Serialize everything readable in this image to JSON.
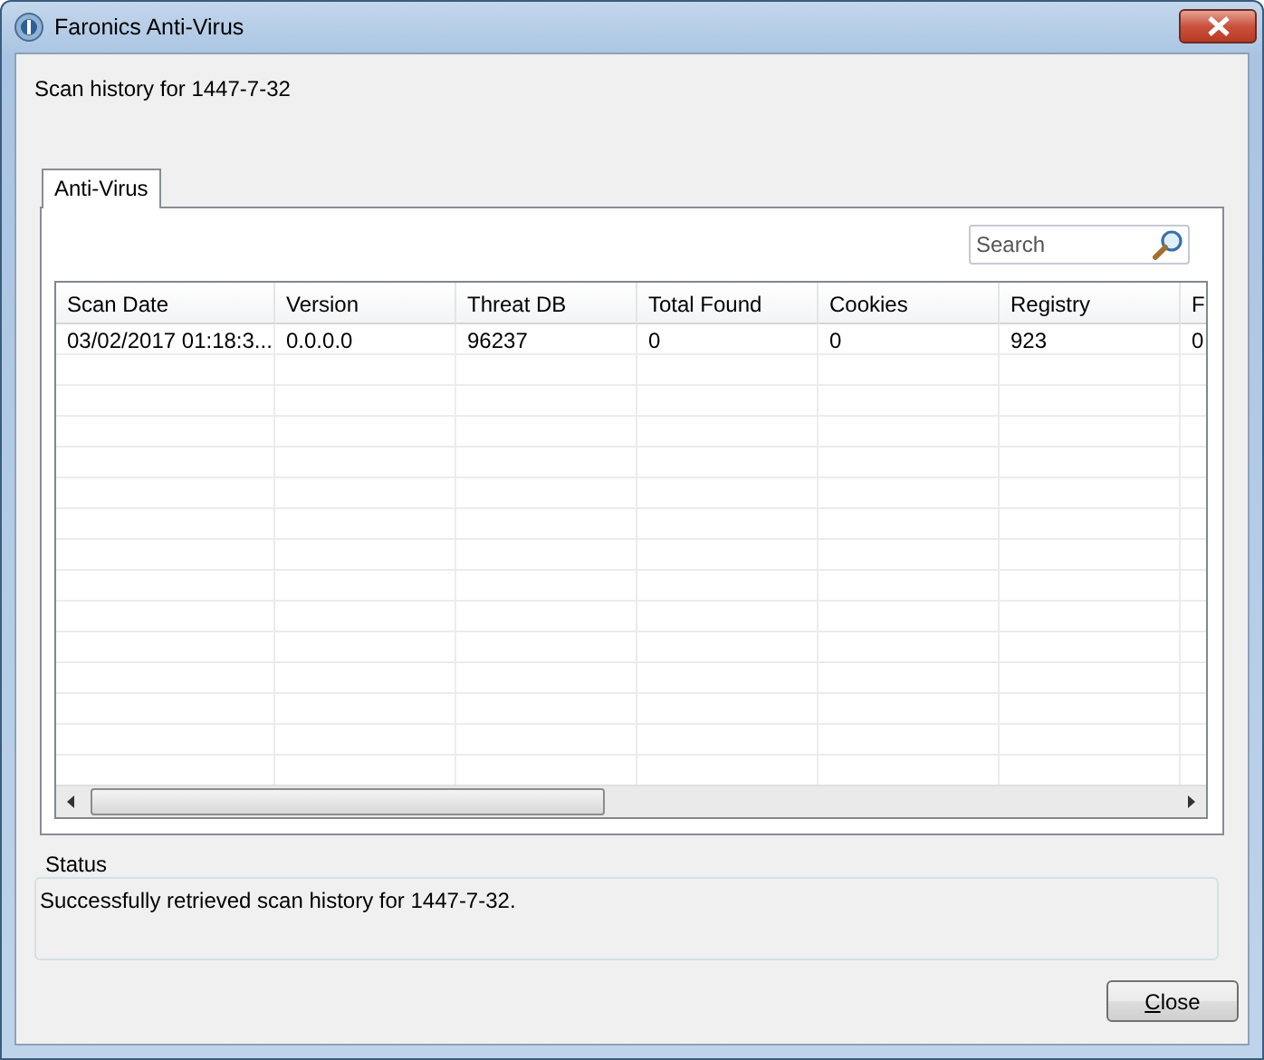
{
  "window": {
    "title": "Faronics Anti-Virus"
  },
  "heading": "Scan history for 1447-7-32",
  "tabs": [
    {
      "label": "Anti-Virus",
      "selected": true
    }
  ],
  "search": {
    "placeholder": "Search"
  },
  "table": {
    "columns": [
      "Scan Date",
      "Version",
      "Threat DB",
      "Total Found",
      "Cookies",
      "Registry",
      "F"
    ],
    "rows": [
      [
        "03/02/2017 01:18:3...",
        "0.0.0.0",
        "96237",
        "0",
        "0",
        "923",
        "0"
      ]
    ]
  },
  "status": {
    "title": "Status",
    "message": "Successfully retrieved scan history for 1447-7-32."
  },
  "buttons": [
    "Close"
  ]
}
